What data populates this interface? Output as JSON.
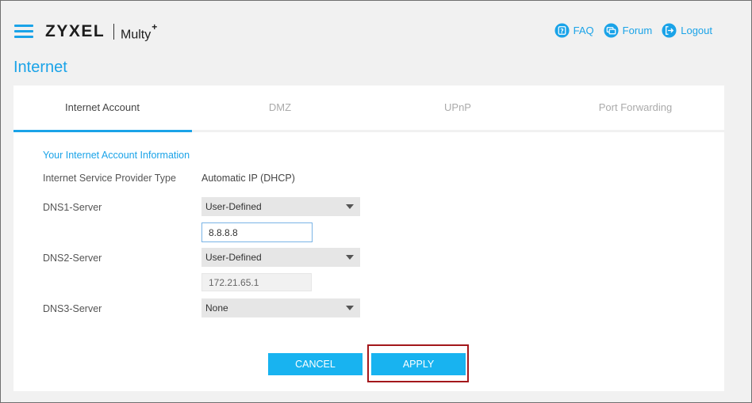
{
  "header": {
    "brand": "ZYXEL",
    "product": "Multy",
    "product_sup": "+",
    "links": [
      {
        "label": "FAQ",
        "icon": "faq-icon"
      },
      {
        "label": "Forum",
        "icon": "forum-icon"
      },
      {
        "label": "Logout",
        "icon": "logout-icon"
      }
    ]
  },
  "page": {
    "title": "Internet"
  },
  "tabs": [
    {
      "label": "Internet Account",
      "active": true
    },
    {
      "label": "DMZ",
      "active": false
    },
    {
      "label": "UPnP",
      "active": false
    },
    {
      "label": "Port Forwarding",
      "active": false
    }
  ],
  "form": {
    "section_title": "Your Internet Account Information",
    "isp_type_label": "Internet Service Provider Type",
    "isp_type_value": "Automatic IP (DHCP)",
    "dns1": {
      "label": "DNS1-Server",
      "mode": "User-Defined",
      "value": "8.8.8.8"
    },
    "dns2": {
      "label": "DNS2-Server",
      "mode": "User-Defined",
      "value": "172.21.65.1"
    },
    "dns3": {
      "label": "DNS3-Server",
      "mode": "None"
    }
  },
  "buttons": {
    "cancel": "CANCEL",
    "apply": "APPLY"
  },
  "colors": {
    "accent": "#1aa3e8",
    "button": "#18b3f0",
    "highlight": "#a3171b"
  }
}
